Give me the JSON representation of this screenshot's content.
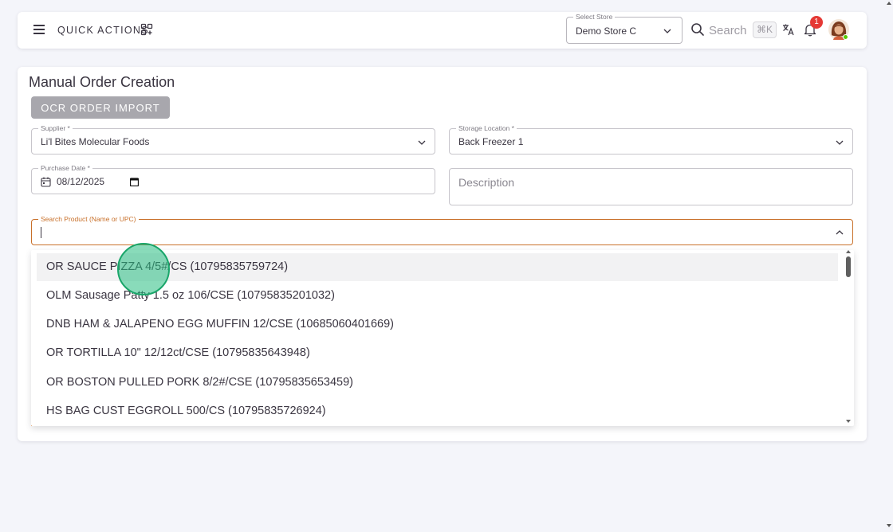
{
  "topbar": {
    "quick_actions_label": "QUICK ACTIONS",
    "store_select": {
      "legend": "Select Store",
      "value": "Demo Store C"
    },
    "search_placeholder": "Search",
    "shortcut": "⌘K",
    "notification_count": "1"
  },
  "form": {
    "title": "Manual Order Creation",
    "ocr_button": "OCR ORDER IMPORT",
    "supplier": {
      "legend": "Supplier *",
      "value": "Li'l Bites Molecular Foods"
    },
    "storage_location": {
      "legend": "Storage Location *",
      "value": "Back Freezer 1"
    },
    "purchase_date": {
      "legend": "Purchase Date *",
      "value": "08/12/2025"
    },
    "description_placeholder": "Description",
    "search_product": {
      "legend": "Search Product (Name or UPC)",
      "value": ""
    }
  },
  "dropdown": {
    "items": [
      "OR SAUCE PIZZA 4/5#/CS (10795835759724)",
      "OLM Sausage Patty 1.5 oz 106/CSE (10795835201032)",
      "DNB HAM & JALAPENO EGG MUFFIN 12/CSE (10685060401669)",
      "OR TORTILLA 10\" 12/12ct/CSE (10795835643948)",
      "OR BOSTON PULLED PORK 8/2#/CSE (10795835653459)",
      "HS BAG CUST EGGROLL 500/CS (10795835726924)"
    ]
  },
  "colors": {
    "accent": "#c8702a",
    "button_disabled": "#a8a7ad",
    "badge": "#e53935",
    "online": "#56ca00"
  }
}
